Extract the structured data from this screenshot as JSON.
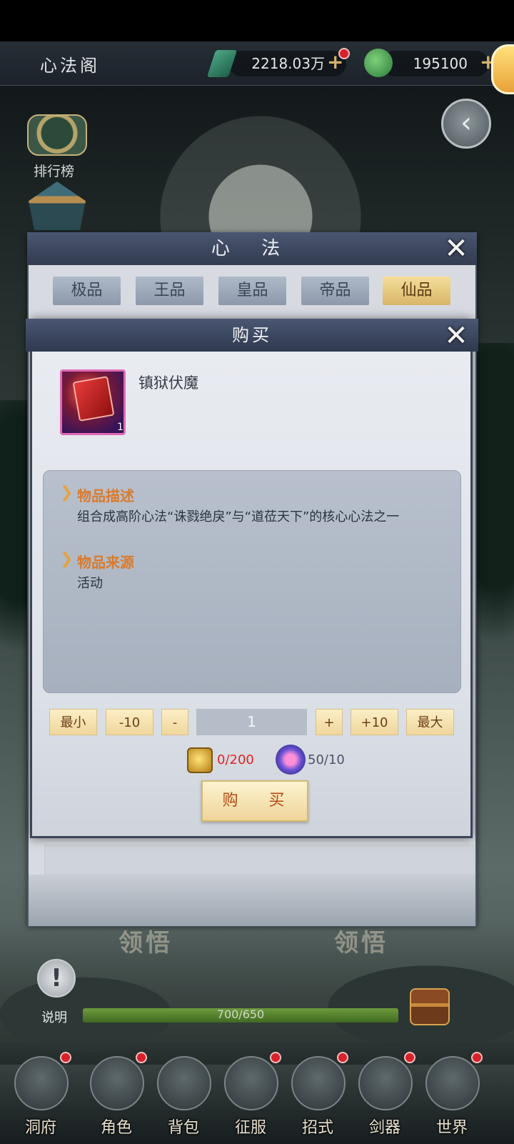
{
  "header": {
    "title": "心法阁",
    "resource_jade": "2218.03万",
    "resource_coin": "195100",
    "plus": "+"
  },
  "side": {
    "rank_label": "排行榜"
  },
  "panel": {
    "title": "心 法",
    "tabs": [
      {
        "label": "极品",
        "active": false
      },
      {
        "label": "王品",
        "active": false
      },
      {
        "label": "皇品",
        "active": false
      },
      {
        "label": "帝品",
        "active": false
      },
      {
        "label": "仙品",
        "active": true
      }
    ]
  },
  "dialog": {
    "title": "购买",
    "item_name": "镇狱伏魔",
    "item_count": "1",
    "desc_title": "物品描述",
    "desc_text": "组合成高阶心法“诛戮绝戾”与“道莅天下”的核心心法之一",
    "source_title": "物品来源",
    "source_text": "活动",
    "qty_buttons": {
      "min": "最小",
      "minus10": "-10",
      "minus": "-",
      "plus": "+",
      "plus10": "+10",
      "max": "最大"
    },
    "quantity": "1",
    "cost1": "0/200",
    "cost2": "50/10",
    "buy_label": "购 买"
  },
  "below": {
    "lingwu_left": "领悟",
    "lingwu_right": "领悟",
    "info_label": "说明",
    "progress_text": "700/650",
    "progress_fraction": 1.0
  },
  "nav": [
    {
      "label": "洞府"
    },
    {
      "label": "角色"
    },
    {
      "label": "背包"
    },
    {
      "label": "征服"
    },
    {
      "label": "招式"
    },
    {
      "label": "剑器"
    },
    {
      "label": "世界"
    }
  ],
  "colors": {
    "accent_orange": "#d97b2c",
    "cost_red": "#e02424",
    "tab_active": "#f4dd9a",
    "badge_red": "#d8222b"
  }
}
